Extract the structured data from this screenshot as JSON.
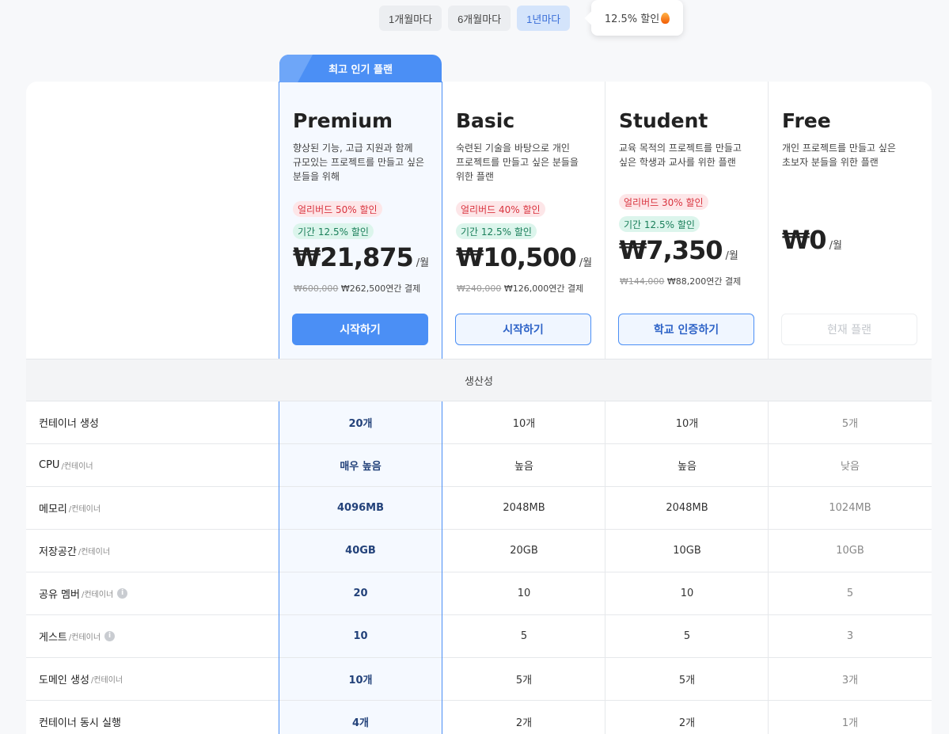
{
  "billing": {
    "options": [
      "1개월마다",
      "6개월마다",
      "1년마다"
    ],
    "active": "1년마다",
    "discount_tip": "12.5% 할인"
  },
  "popular_tag": "최고 인기 플랜",
  "plans": [
    {
      "name": "Premium",
      "desc": "향상된 기능, 고급 지원과 함께\n규모있는 프로젝트를 만들고 싶은\n분들을 위해",
      "early_badge": "얼리버드 50% 할인",
      "period_badge": "기간 12.5% 할인",
      "price": "₩21,875",
      "unit": "/월",
      "original": "₩600,000",
      "annual": "₩262,500연간 결제",
      "cta": "시작하기"
    },
    {
      "name": "Basic",
      "desc": "숙련된 기술을 바탕으로 개인\n프로젝트를 만들고 싶은 분들을\n위한 플랜",
      "early_badge": "얼리버드 40% 할인",
      "period_badge": "기간 12.5% 할인",
      "price": "₩10,500",
      "unit": "/월",
      "original": "₩240,000",
      "annual": "₩126,000연간 결제",
      "cta": "시작하기"
    },
    {
      "name": "Student",
      "desc": "교육 목적의 프로젝트를 만들고\n싶은 학생과 교사를 위한 플랜",
      "early_badge": "얼리버드 30% 할인",
      "period_badge": "기간 12.5% 할인",
      "price": "₩7,350",
      "unit": "/월",
      "original": "₩144,000",
      "annual": "₩88,200연간 결제",
      "cta": "학교 인증하기"
    },
    {
      "name": "Free",
      "desc": "개인 프로젝트를 만들고 싶은\n초보자 분들을 위한 플랜",
      "price": "₩0",
      "unit": "/월",
      "cta": "현재 플랜"
    }
  ],
  "section_title": "생산성",
  "features": [
    {
      "label": "컨테이너 생성",
      "per": "",
      "info": false,
      "values": [
        "20개",
        "10개",
        "10개",
        "5개"
      ]
    },
    {
      "label": "CPU",
      "per": "/컨테이너",
      "info": false,
      "values": [
        "매우 높음",
        "높음",
        "높음",
        "낮음"
      ]
    },
    {
      "label": "메모리",
      "per": "/컨테이너",
      "info": false,
      "values": [
        "4096MB",
        "2048MB",
        "2048MB",
        "1024MB"
      ]
    },
    {
      "label": "저장공간",
      "per": "/컨테이너",
      "info": false,
      "values": [
        "40GB",
        "20GB",
        "10GB",
        "10GB"
      ]
    },
    {
      "label": "공유 멤버",
      "per": "/컨테이너",
      "info": true,
      "values": [
        "20",
        "10",
        "10",
        "5"
      ]
    },
    {
      "label": "게스트",
      "per": "/컨테이너",
      "info": true,
      "values": [
        "10",
        "5",
        "5",
        "3"
      ]
    },
    {
      "label": "도메인 생성",
      "per": "/컨테이너",
      "info": false,
      "values": [
        "10개",
        "5개",
        "5개",
        "3개"
      ]
    },
    {
      "label": "컨테이너 동시 실행",
      "per": "",
      "info": false,
      "values": [
        "4개",
        "2개",
        "2개",
        "1개"
      ]
    }
  ]
}
